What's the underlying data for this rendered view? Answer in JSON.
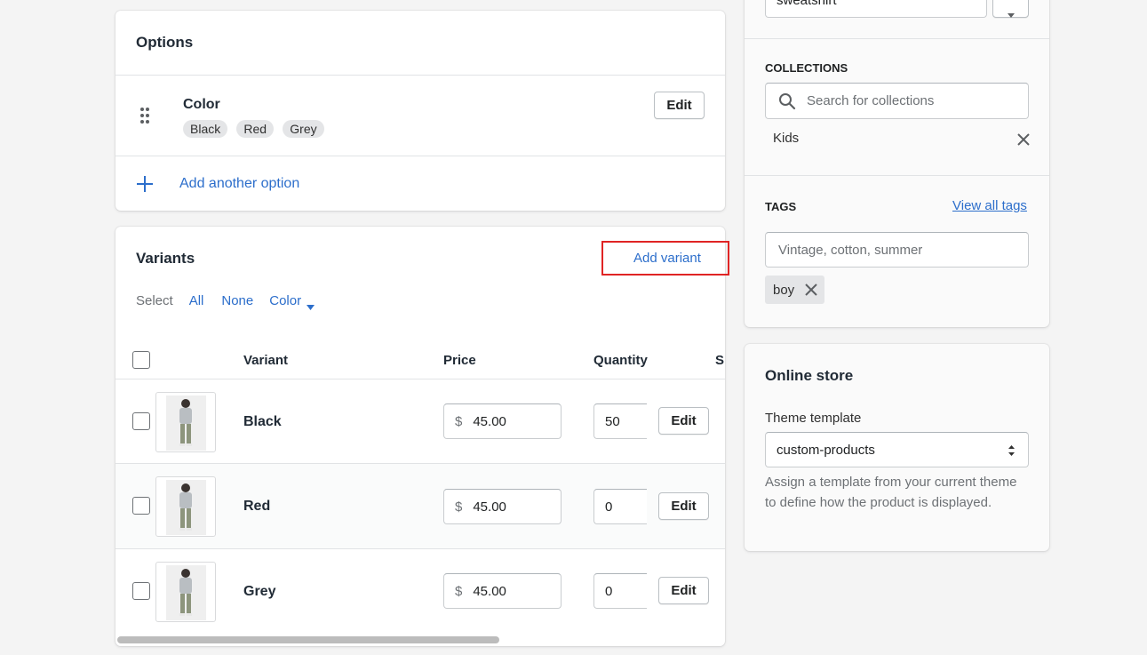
{
  "options_card": {
    "title": "Options",
    "option": {
      "name": "Color",
      "values": [
        "Black",
        "Red",
        "Grey"
      ],
      "edit_label": "Edit"
    },
    "add_option_label": "Add another option"
  },
  "variants_card": {
    "title": "Variants",
    "add_variant_label": "Add variant",
    "select_label": "Select",
    "select_all": "All",
    "select_none": "None",
    "select_color": "Color",
    "columns": {
      "variant": "Variant",
      "price": "Price",
      "quantity": "Quantity",
      "sku": "Sl"
    },
    "currency_symbol": "$",
    "rows": [
      {
        "name": "Black",
        "price": "45.00",
        "quantity": "50",
        "edit_label": "Edit"
      },
      {
        "name": "Red",
        "price": "45.00",
        "quantity": "0",
        "edit_label": "Edit"
      },
      {
        "name": "Grey",
        "price": "45.00",
        "quantity": "0",
        "edit_label": "Edit"
      }
    ]
  },
  "organization": {
    "product_type_value": "sweatshirt",
    "collections_label": "COLLECTIONS",
    "collections_placeholder": "Search for collections",
    "collections": [
      "Kids"
    ],
    "tags_label": "TAGS",
    "view_all_tags": "View all tags",
    "tags_placeholder": "Vintage, cotton, summer",
    "tags": [
      "boy"
    ]
  },
  "online_store": {
    "title": "Online store",
    "theme_template_label": "Theme template",
    "theme_template_value": "custom-products",
    "help_text": "Assign a template from your current theme to define how the product is displayed."
  },
  "colors": {
    "accent": "#2c6ecb",
    "highlight_box": "#e02424"
  }
}
